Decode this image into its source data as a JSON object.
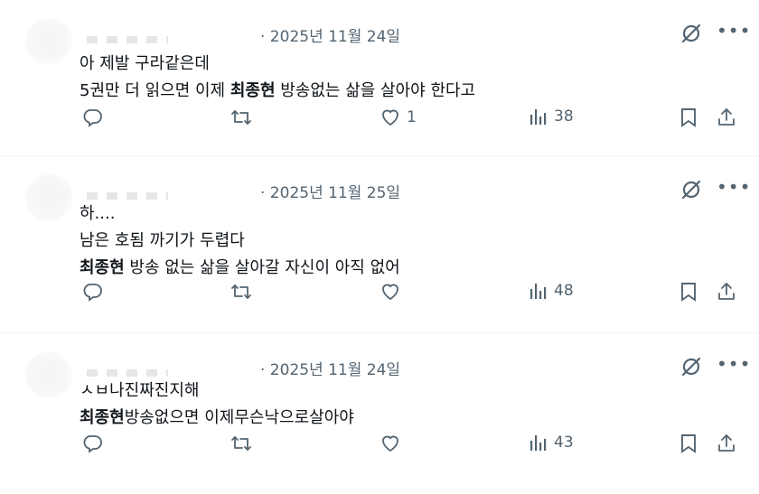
{
  "posts": [
    {
      "date": "· 2025년 11월 24일",
      "lines": [
        {
          "parts": [
            {
              "text": "아 제발 구라같은데",
              "bold": false
            }
          ]
        },
        {
          "parts": [
            {
              "text": "5권만 더 읽으면 이제 ",
              "bold": false
            },
            {
              "text": "최종현",
              "bold": true
            },
            {
              "text": " 방송없는 삶을 살아야 한다고",
              "bold": false
            }
          ]
        }
      ],
      "likes": "1",
      "views": "38"
    },
    {
      "date": "· 2025년 11월 25일",
      "lines": [
        {
          "parts": [
            {
              "text": "하....",
              "bold": false
            }
          ]
        },
        {
          "parts": [
            {
              "text": "남은 호됨 까기가 두렵다",
              "bold": false
            }
          ]
        },
        {
          "parts": [
            {
              "text": "최종현",
              "bold": true
            },
            {
              "text": " 방송 없는 삶을 살아갈 자신이 아직 없어",
              "bold": false
            }
          ]
        }
      ],
      "likes": "",
      "views": "48"
    },
    {
      "date": "· 2025년 11월 24일",
      "lines": [
        {
          "parts": [
            {
              "text": "ㅅㅂ나진짜진지해",
              "bold": false
            }
          ]
        },
        {
          "parts": [
            {
              "text": "최종현",
              "bold": true
            },
            {
              "text": "방송없으면 이제무슨낙으로살아야",
              "bold": false
            }
          ]
        }
      ],
      "likes": "",
      "views": "43"
    }
  ],
  "icons": {
    "reply": "reply-icon",
    "repost": "repost-icon",
    "like": "heart-icon",
    "views": "views-icon",
    "bookmark": "bookmark-icon",
    "share": "share-icon",
    "grok": "grok-icon",
    "more": "more-icon"
  },
  "colors": {
    "text": "#0f1419",
    "muted": "#536471",
    "divider": "#eff3f4"
  }
}
